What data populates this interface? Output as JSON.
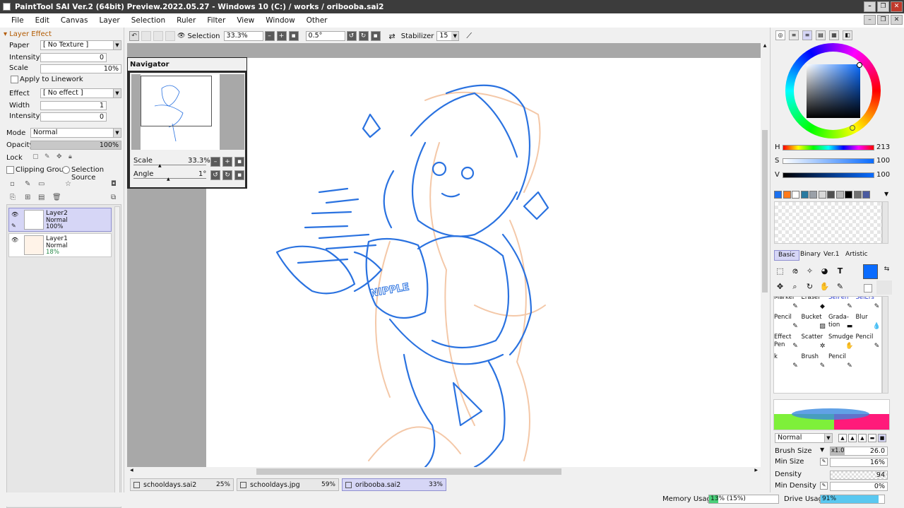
{
  "window": {
    "title": "PaintTool SAI Ver.2 (64bit) Preview.2022.05.27 - Windows 10 (C:) / works / oribooba.sai2"
  },
  "menu": [
    "File",
    "Edit",
    "Canvas",
    "Layer",
    "Selection",
    "Ruler",
    "Filter",
    "View",
    "Window",
    "Other"
  ],
  "layer_effect": {
    "header": "Layer Effect",
    "paper_label": "Paper",
    "paper_value": "[ No Texture ]",
    "intensity_label": "Intensity",
    "intensity_value": "0",
    "scale_label": "Scale",
    "scale_value": "10%",
    "apply_linework": "Apply to Linework",
    "effect_label": "Effect",
    "effect_value": "[ No effect ]",
    "width_label": "Width",
    "width_value": "1",
    "intensity2_label": "Intensity",
    "intensity2_value": "0"
  },
  "layer_props": {
    "mode_label": "Mode",
    "mode_value": "Normal",
    "opacity_label": "Opacity",
    "opacity_value": "100%",
    "lock_label": "Lock",
    "clipping_group": "Clipping Group",
    "selection_source": "Selection Source"
  },
  "layers": [
    {
      "name": "Layer2",
      "mode": "Normal",
      "opacity": "100%",
      "selected": true
    },
    {
      "name": "Layer1",
      "mode": "Normal",
      "opacity": "18%",
      "selected": false
    }
  ],
  "toolbar": {
    "selection_label": "Selection",
    "zoom_value": "33.3%",
    "angle_value": "0.5°",
    "stabilizer_label": "Stabilizer",
    "stabilizer_value": "15"
  },
  "navigator": {
    "title": "Navigator",
    "scale_label": "Scale",
    "scale_value": "33.3%",
    "angle_label": "Angle",
    "angle_value": "1°"
  },
  "canvas_text": "NIPPLE",
  "tabs": [
    {
      "name": "schooldays.sai2",
      "pct": "25%",
      "active": false
    },
    {
      "name": "schooldays.jpg",
      "pct": "59%",
      "active": false
    },
    {
      "name": "oribooba.sai2",
      "pct": "33%",
      "active": true
    }
  ],
  "status": {
    "memory_label": "Memory Usage",
    "memory_value": "13% (15%)",
    "memory_fraction": 0.13,
    "drive_label": "Drive Usage",
    "drive_value": "91%",
    "drive_fraction": 0.91
  },
  "color": {
    "h_label": "H",
    "h_value": "213",
    "s_label": "S",
    "s_value": "100",
    "v_label": "V",
    "v_value": "100",
    "current": "#0a6cff",
    "swatches": [
      "#1a70f0",
      "#ff7a1a",
      "#ffffff",
      "#2a7aa0",
      "#9aa0a8",
      "#d8d8d8",
      "#505050",
      "#b8b8b8",
      "#000000",
      "#707070",
      "#4a5aa0"
    ]
  },
  "brush_sets": [
    "Basic",
    "Binary",
    "Ver.1",
    "Artistic"
  ],
  "brushes": [
    {
      "label": "Marker"
    },
    {
      "label": "Eraser"
    },
    {
      "label": "SelPen"
    },
    {
      "label": "SelErs"
    },
    {
      "label": "Pencil"
    },
    {
      "label": "Bucket"
    },
    {
      "label": "Grada-\ntion"
    },
    {
      "label": "Blur"
    },
    {
      "label": "Effect\nPen"
    },
    {
      "label": "Scatter"
    },
    {
      "label": "Smudge"
    },
    {
      "label": "Pencil"
    },
    {
      "label": "k"
    },
    {
      "label": "Brush"
    },
    {
      "label": "Pencil"
    },
    {
      "label": ""
    }
  ],
  "brush_props": {
    "mode_value": "Normal",
    "size_label": "Brush Size",
    "size_mult": "x1.0",
    "size_value": "26.0",
    "minsize_label": "Min Size",
    "minsize_value": "16%",
    "density_label": "Density",
    "density_value": "94",
    "mindensity_label": "Min Density",
    "mindensity_value": "0%"
  }
}
